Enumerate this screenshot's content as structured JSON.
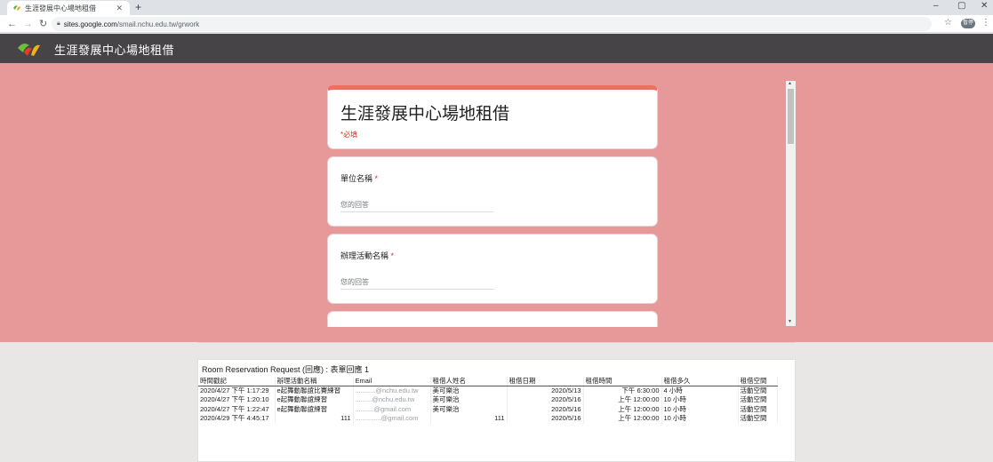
{
  "browser": {
    "tab_title": "生涯發展中心場地租借",
    "new_tab": "+",
    "url_host": "sites.google.com",
    "url_path": "/smail.nchu.edu.tw/grwork",
    "profile_label": "暫停",
    "window_controls": [
      "–",
      "▢",
      "✕"
    ]
  },
  "site": {
    "title": "生涯發展中心場地租借"
  },
  "form": {
    "title": "生涯發展中心場地租借",
    "required_note": "*必填",
    "questions": [
      {
        "label": "單位名稱",
        "required_mark": " *",
        "placeholder": "您的回答"
      },
      {
        "label": "辦理活動名稱",
        "required_mark": " *",
        "placeholder": "您的回答"
      }
    ]
  },
  "sheet": {
    "title": "Room Reservation Request (回應) : 表單回應 1",
    "columns": [
      "時間戳記",
      "辦理活動名稱",
      "Email",
      "租借人姓名",
      "租借日期",
      "租借時間",
      "租借多久",
      "租借空間"
    ],
    "rows": [
      [
        "2020/4/27 下午 1:17:29",
        "e起舞動聯誼比賽練習",
        "...........@nchu.edu.tw",
        "美可樂治",
        "2020/5/13",
        "下午 6:30:00",
        "4 小時",
        "活動空間"
      ],
      [
        "2020/4/27 下午 1:20:10",
        "e起舞動聯誼練習",
        ".........@nchu.edu.tw",
        "美可樂治",
        "2020/5/16",
        "上午 12:00:00",
        "10 小時",
        "活動空間"
      ],
      [
        "2020/4/27 下午 1:22:47",
        "e起舞動聯誼練習",
        "..........@gmail.com",
        "美可樂治",
        "2020/5/16",
        "上午 12:00:00",
        "10 小時",
        "活動空間"
      ],
      [
        "2020/4/29 下午 4:45:17",
        "111",
        "..............@gmail.com",
        "111",
        "2020/5/16",
        "上午 12:00:00",
        "10 小時",
        "活動空間"
      ]
    ]
  },
  "colors": {
    "header_bg": "#474447",
    "band_bg": "#e79898",
    "form_accent": "#e8725f",
    "required": "#d93025"
  }
}
